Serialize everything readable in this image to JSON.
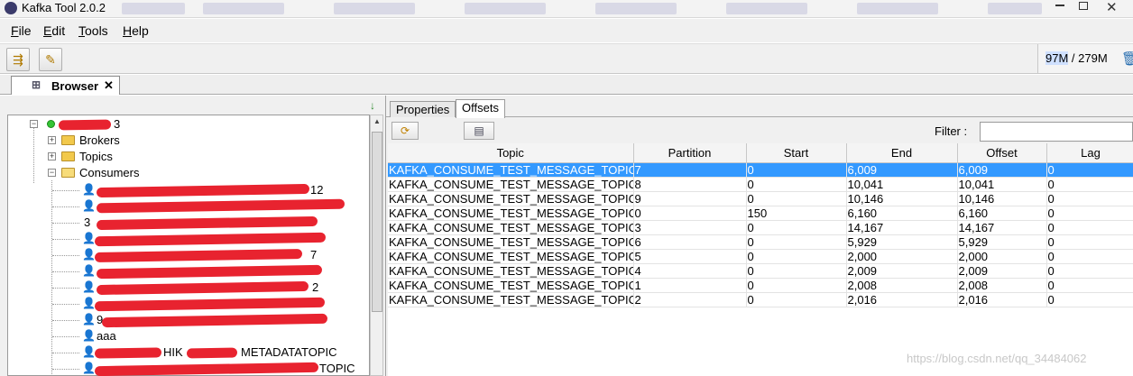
{
  "window": {
    "title": "Kafka Tool  2.0.2"
  },
  "menu": {
    "items": [
      {
        "mnemonic": "F",
        "rest": "ile"
      },
      {
        "mnemonic": "E",
        "rest": "dit"
      },
      {
        "mnemonic": "T",
        "rest": "ools"
      },
      {
        "mnemonic": "H",
        "rest": "elp"
      }
    ]
  },
  "toolbar": {
    "memory_used": "97M",
    "memory_sep": " / ",
    "memory_total": "279M"
  },
  "tabs": {
    "browser_label": "Browser",
    "close_glyph": "✕"
  },
  "tree": {
    "root_suffix": "3",
    "brokers": "Brokers",
    "topics": "Topics",
    "consumers": "Consumers",
    "consumer_fragments": [
      "12",
      "3",
      "7",
      "2",
      "9",
      "aaa",
      "HIK",
      "METADATA",
      "TOPIC",
      "TOPIC"
    ]
  },
  "details": {
    "tabs": [
      "Properties",
      "Offsets"
    ],
    "active_tab": "Offsets",
    "filter_label": "Filter :",
    "filter_value": ""
  },
  "offsets_table": {
    "columns": [
      "Topic",
      "Partition",
      "Start",
      "End",
      "Offset",
      "Lag"
    ],
    "rows": [
      [
        "KAFKA_CONSUME_TEST_MESSAGE_TOPIC",
        "7",
        "0",
        "6,009",
        "6,009",
        "0"
      ],
      [
        "KAFKA_CONSUME_TEST_MESSAGE_TOPIC",
        "8",
        "0",
        "10,041",
        "10,041",
        "0"
      ],
      [
        "KAFKA_CONSUME_TEST_MESSAGE_TOPIC",
        "9",
        "0",
        "10,146",
        "10,146",
        "0"
      ],
      [
        "KAFKA_CONSUME_TEST_MESSAGE_TOPIC",
        "0",
        "150",
        "6,160",
        "6,160",
        "0"
      ],
      [
        "KAFKA_CONSUME_TEST_MESSAGE_TOPIC",
        "3",
        "0",
        "14,167",
        "14,167",
        "0"
      ],
      [
        "KAFKA_CONSUME_TEST_MESSAGE_TOPIC",
        "6",
        "0",
        "5,929",
        "5,929",
        "0"
      ],
      [
        "KAFKA_CONSUME_TEST_MESSAGE_TOPIC",
        "5",
        "0",
        "2,000",
        "2,000",
        "0"
      ],
      [
        "KAFKA_CONSUME_TEST_MESSAGE_TOPIC",
        "4",
        "0",
        "2,009",
        "2,009",
        "0"
      ],
      [
        "KAFKA_CONSUME_TEST_MESSAGE_TOPIC",
        "1",
        "0",
        "2,008",
        "2,008",
        "0"
      ],
      [
        "KAFKA_CONSUME_TEST_MESSAGE_TOPIC",
        "2",
        "0",
        "2,016",
        "2,016",
        "0"
      ]
    ],
    "selected_row": 0
  },
  "watermark": "https://blog.csdn.net/qq_34484062",
  "colors": {
    "selection": "#3399ff",
    "redaction": "#e8232f",
    "connected": "#35c435"
  }
}
